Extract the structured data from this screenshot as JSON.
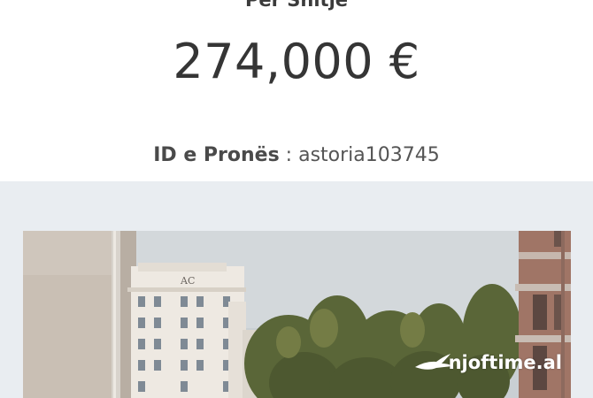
{
  "listing": {
    "type_label": "Per Shitje",
    "price": "274,000 €",
    "id_label": "ID e Pronës",
    "id_separator": " : ",
    "id_value": "astoria103745"
  },
  "photo": {
    "watermark_text": "njoftime.al",
    "building_sign": "AC"
  },
  "colors": {
    "text_dark": "#353535",
    "gallery_bg": "#e9edf1",
    "page_bg": "#ffffff"
  }
}
